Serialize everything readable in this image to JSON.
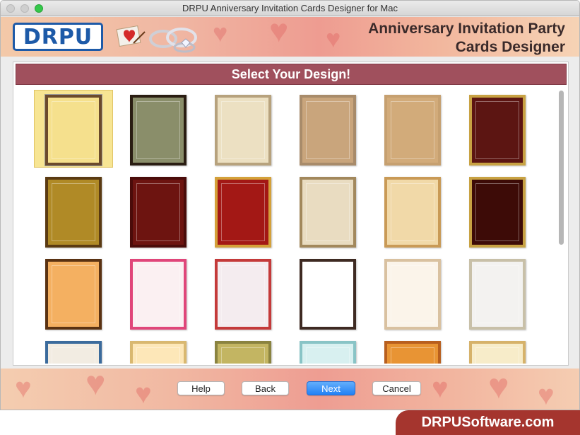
{
  "window": {
    "title": "DRPU Anniversary Invitation Cards Designer for Mac"
  },
  "banner": {
    "logo_text": "DRPU",
    "title_line1": "Anniversary Invitation Party",
    "title_line2": "Cards Designer"
  },
  "panel": {
    "heading": "Select Your Design!"
  },
  "designs": [
    {
      "bg": "#f5e08d",
      "frame": "#6b4a2c",
      "selected": true
    },
    {
      "bg": "#8a8e6a",
      "frame": "#2a1d12"
    },
    {
      "bg": "#ece0c2",
      "frame": "#b7a27d"
    },
    {
      "bg": "#c9a57c",
      "frame": "#a88b6a"
    },
    {
      "bg": "#d2ab7a",
      "frame": "#c6a070"
    },
    {
      "bg": "#5c1512",
      "frame": "#c8a243"
    },
    {
      "bg": "#b08a26",
      "frame": "#5a3a12"
    },
    {
      "bg": "#6d1410",
      "frame": "#4a0c0a"
    },
    {
      "bg": "#a31815",
      "frame": "#d4a13a"
    },
    {
      "bg": "#e9dcc1",
      "frame": "#a2885c"
    },
    {
      "bg": "#f1d9a8",
      "frame": "#c99a56"
    },
    {
      "bg": "#3d0b07",
      "frame": "#c8a243"
    },
    {
      "bg": "#f4b061",
      "frame": "#5a3212"
    },
    {
      "bg": "#fbf0f2",
      "frame": "#e0467a"
    },
    {
      "bg": "#f4ecef",
      "frame": "#c43a3a"
    },
    {
      "bg": "#ffffff",
      "frame": "#3e2a22"
    },
    {
      "bg": "#fbf4ea",
      "frame": "#d9c1a0"
    },
    {
      "bg": "#f3f2f0",
      "frame": "#c8c0a8"
    },
    {
      "bg": "#f2ece2",
      "frame": "#3b6b9c"
    },
    {
      "bg": "#fde7b8",
      "frame": "#d9b870"
    },
    {
      "bg": "#c3b562",
      "frame": "#8a8340"
    },
    {
      "bg": "#d8f0f0",
      "frame": "#89c4c6"
    },
    {
      "bg": "#e89434",
      "frame": "#b85f1e"
    },
    {
      "bg": "#f7ecc9",
      "frame": "#d6b26a"
    }
  ],
  "buttons": {
    "help": "Help",
    "back": "Back",
    "next": "Next",
    "cancel": "Cancel"
  },
  "watermark": "DRPUSoftware.com",
  "colors": {
    "heading_bar": "#a0505d",
    "primary_button": "#2281f5",
    "watermark_bg": "#a5352e"
  }
}
